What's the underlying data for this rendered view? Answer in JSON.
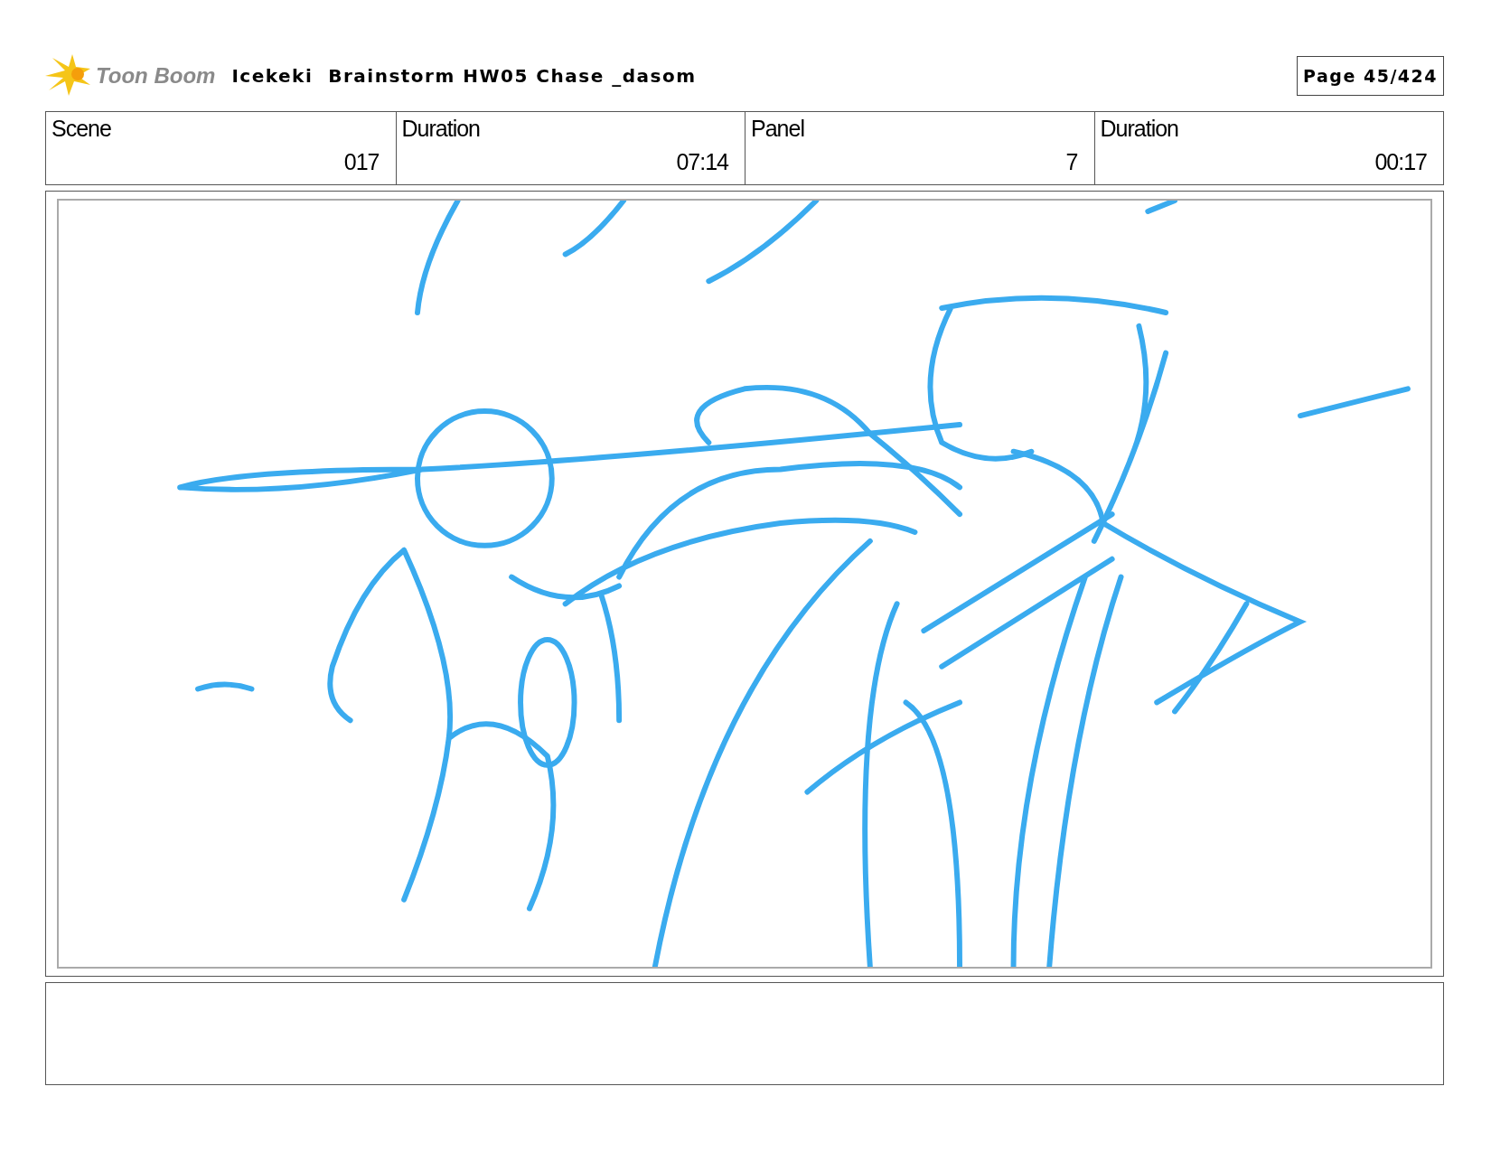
{
  "header": {
    "logo_text": "Toon Boom",
    "title": "Icekeki  Brainstorm HW05 Chase _dasom",
    "page": "Page 45/424"
  },
  "fields": [
    {
      "label": "Scene",
      "value": "017"
    },
    {
      "label": "Duration",
      "value": "07:14"
    },
    {
      "label": "Panel",
      "value": "7"
    },
    {
      "label": "Duration",
      "value": "00:17"
    }
  ]
}
